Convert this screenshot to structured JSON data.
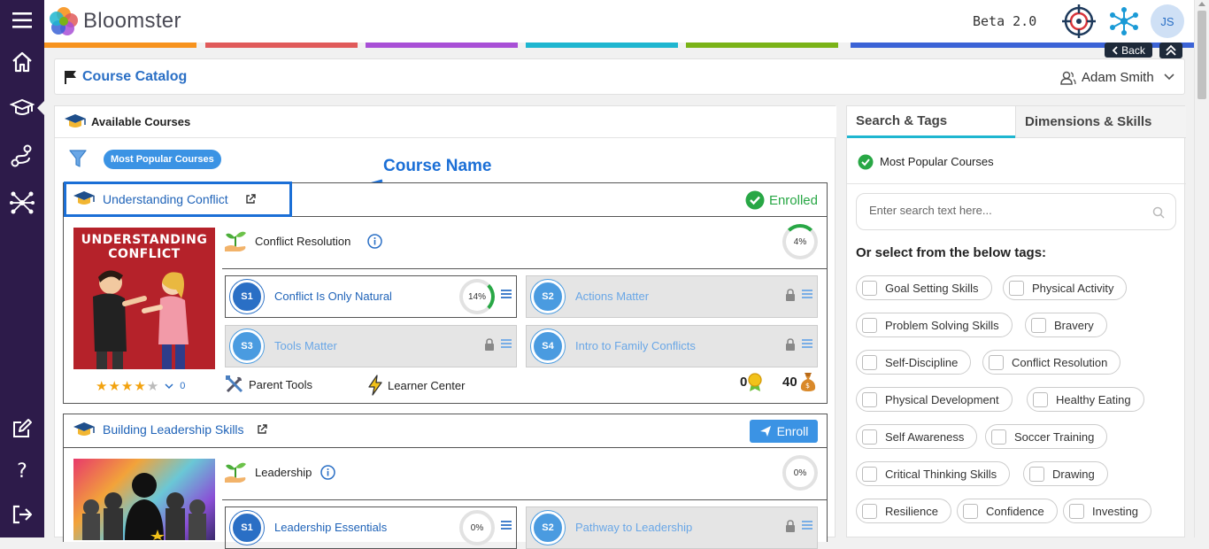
{
  "app": {
    "name": "Bloomster",
    "version_label": "Beta 2.0",
    "user_initials": "JS"
  },
  "nav": {
    "back_label": "Back"
  },
  "stripes": [
    "#f7931e",
    "#e05a5a",
    "#a84fd6",
    "#1fb6d0",
    "#7ab317",
    "#3b63d6"
  ],
  "catalog": {
    "title": "Course Catalog",
    "user_name": "Adam Smith"
  },
  "available": {
    "title": "Available Courses",
    "filter_pill": "Most Popular Courses",
    "annotation": "Course Name"
  },
  "courses": [
    {
      "name": "Understanding Conflict",
      "status": "Enrolled",
      "skill": "Conflict Resolution",
      "skill_progress": "4%",
      "rating": 4.5,
      "rating_count": "0",
      "tools_label": "Parent Tools",
      "learner_label": "Learner Center",
      "badges_count": "0",
      "bags_count": "40",
      "image_title": "UNDERSTANDING CONFLICT",
      "sections": [
        {
          "badge": "S1",
          "name": "Conflict Is Only Natural",
          "progress": "14%",
          "locked": false
        },
        {
          "badge": "S2",
          "name": "Actions Matter",
          "locked": true
        },
        {
          "badge": "S3",
          "name": "Tools Matter",
          "locked": true
        },
        {
          "badge": "S4",
          "name": "Intro to Family Conflicts",
          "locked": true
        }
      ]
    },
    {
      "name": "Building Leadership Skills",
      "enroll_label": "Enroll",
      "skill": "Leadership",
      "skill_progress": "0%",
      "sections": [
        {
          "badge": "S1",
          "name": "Leadership Essentials",
          "progress": "0%",
          "locked": false
        },
        {
          "badge": "S2",
          "name": "Pathway to Leadership",
          "locked": true
        }
      ]
    }
  ],
  "right": {
    "tabs": [
      "Search & Tags",
      "Dimensions & Skills"
    ],
    "selected_tag": "Most Popular Courses",
    "search_placeholder": "Enter search text here...",
    "tags_heading": "Or select from the below tags:",
    "tags": [
      "Goal Setting Skills",
      "Physical Activity",
      "Problem Solving Skills",
      "Bravery",
      "Self-Discipline",
      "Conflict Resolution",
      "Physical Development",
      "Healthy Eating",
      "Self Awareness",
      "Soccer Training",
      "Critical Thinking Skills",
      "Drawing",
      "Resilience",
      "Confidence",
      "Investing"
    ]
  }
}
